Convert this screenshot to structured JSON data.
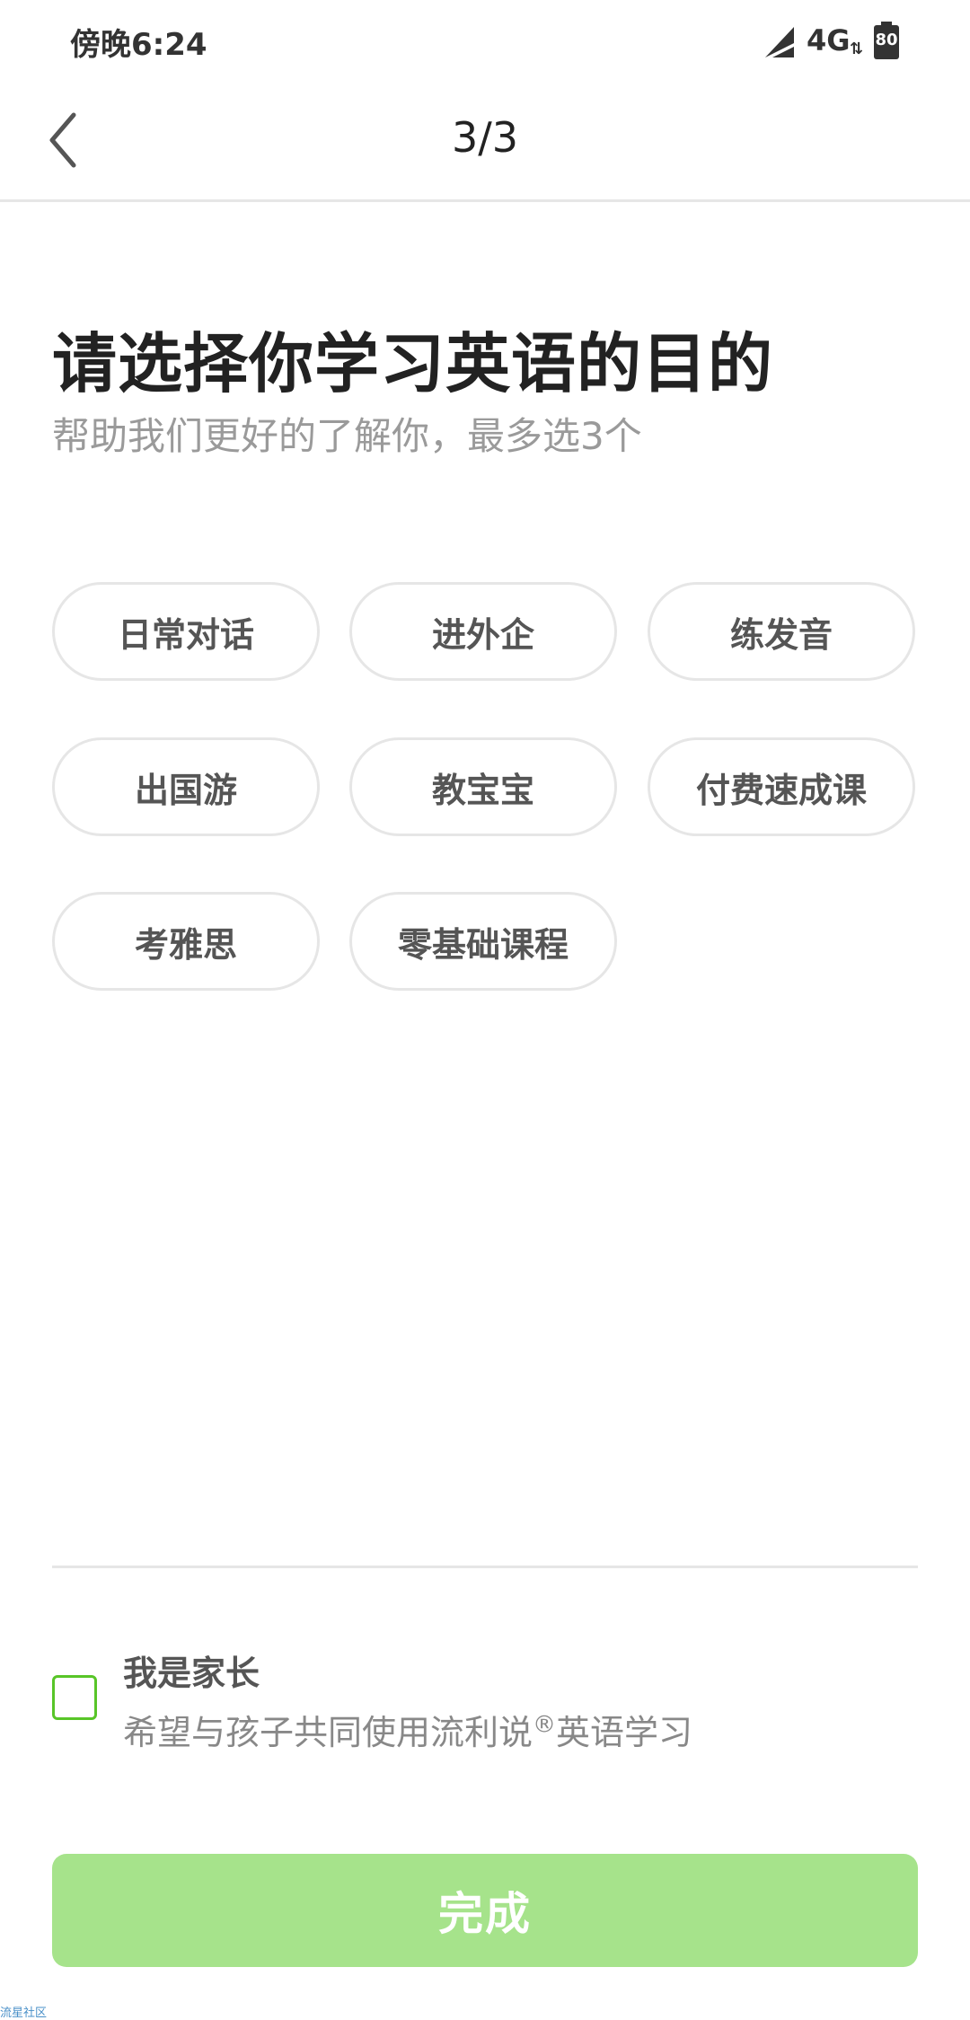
{
  "status_bar": {
    "time": "傍晚6:24",
    "network": "4G",
    "data_arrows": "⇅",
    "battery": "80"
  },
  "nav": {
    "back_icon": "chevron-left-icon",
    "step": "3/3"
  },
  "header": {
    "title": "请选择你学习英语的目的",
    "subtitle": "帮助我们更好的了解你，最多选3个"
  },
  "options": [
    {
      "label": "日常对话"
    },
    {
      "label": "进外企"
    },
    {
      "label": "练发音"
    },
    {
      "label": "出国游"
    },
    {
      "label": "教宝宝"
    },
    {
      "label": "付费速成课"
    },
    {
      "label": "考雅思"
    },
    {
      "label": "零基础课程"
    }
  ],
  "parent": {
    "checked": false,
    "title": "我是家长",
    "desc_main": "希望与孩子共同使用流利说",
    "desc_mark": "®",
    "desc_tail": "英语学习"
  },
  "finish_button": {
    "label": "完成"
  },
  "watermark": "流星社区",
  "colors": {
    "accent": "#58c528",
    "button_disabled": "#a6e38b",
    "chip_border": "#e6e6e6"
  }
}
